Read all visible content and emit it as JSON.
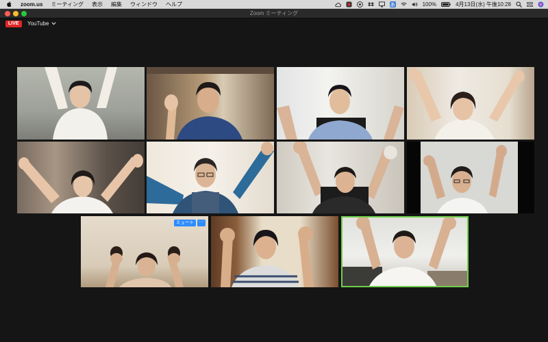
{
  "menubar": {
    "app_name": "zoom.us",
    "items": [
      "ミーティング",
      "表示",
      "編集",
      "ウィンドウ",
      "ヘルプ"
    ],
    "battery": "100%",
    "datetime": "4月13日(水) 午後10:28",
    "input_source": "あ"
  },
  "window": {
    "title": "Zoom ミーティング"
  },
  "livestream": {
    "badge": "LIVE",
    "target": "YouTube"
  },
  "tiles": {
    "t10": {
      "mute_label": "ミュート",
      "more_label": "···"
    }
  },
  "colors": {
    "active_speaker_border": "#6fd04a",
    "live_red": "#e02828",
    "zoom_blue": "#2d8cff"
  }
}
